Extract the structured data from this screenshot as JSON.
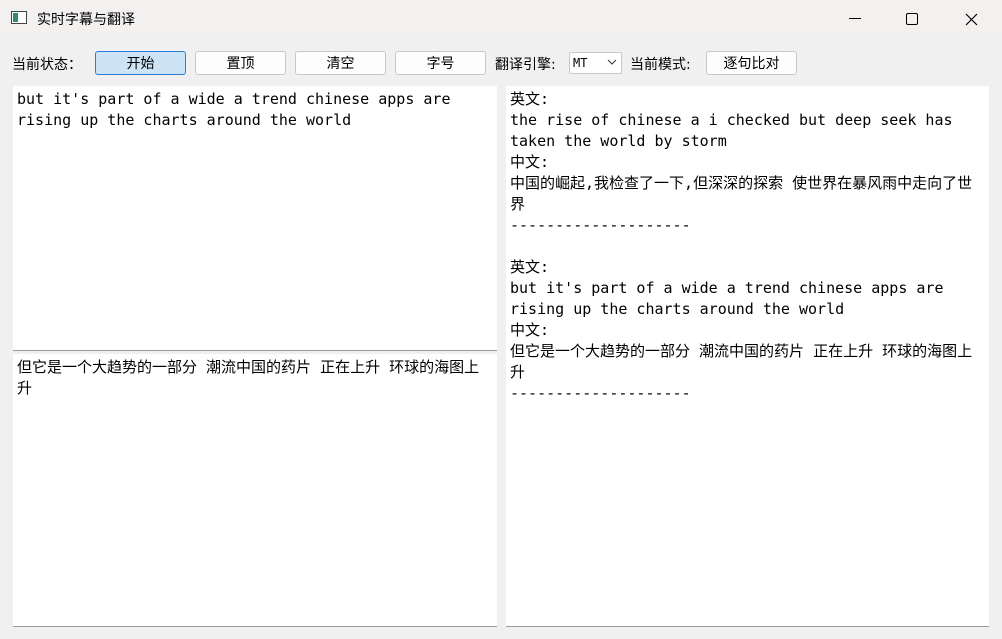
{
  "window": {
    "title": "实时字幕与翻译",
    "controls": [
      "minimize-icon",
      "maximize-icon",
      "close-icon"
    ]
  },
  "toolbar": {
    "status_label": "当前状态：",
    "start_button": "开始",
    "pin_button": "置顶",
    "clear_button": "清空",
    "font_button": "字号",
    "engine_label": "翻译引擎:",
    "engine_value": "MT",
    "mode_label": "当前模式:",
    "mode_button": "逐句比对"
  },
  "panes": {
    "source_text": "but it's part of a wide a trend chinese apps are rising up the charts around the world",
    "translation_text": "但它是一个大趋势的一部分 潮流中国的药片 正在上升 环球的海图上升",
    "history": [
      {
        "en_label": "英文:",
        "en_text": "the rise of chinese a i checked but deep seek has taken the world by storm",
        "zh_label": "中文:",
        "zh_text": "中国的崛起,我检查了一下,但深深的探索 使世界在暴风雨中走向了世界",
        "separator": "--------------------"
      },
      {
        "en_label": "英文:",
        "en_text": "but it's part of a wide a trend chinese apps are rising up the charts around the world",
        "zh_label": "中文:",
        "zh_text": "但它是一个大趋势的一部分 潮流中国的药片 正在上升 环球的海图上升",
        "separator": "--------------------"
      }
    ]
  },
  "colors": {
    "primary_button_bg": "#cde4f7",
    "primary_button_border": "#2b7fd0",
    "window_bg": "#f0f0f0"
  }
}
